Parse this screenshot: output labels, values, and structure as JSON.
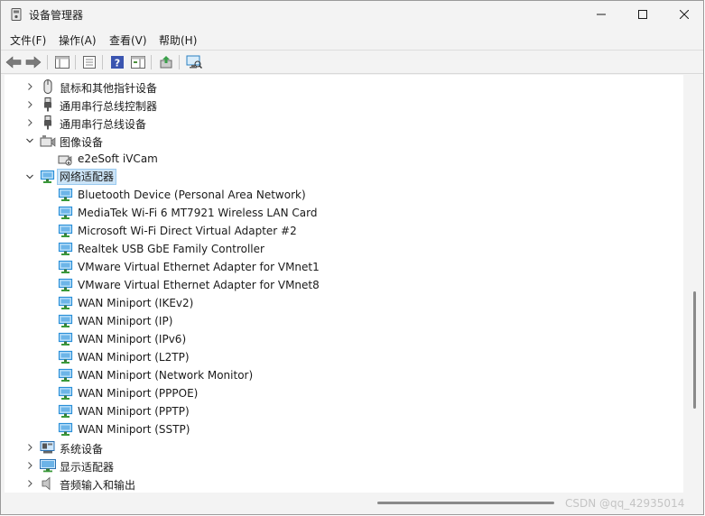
{
  "window": {
    "title": "设备管理器"
  },
  "menu": [
    {
      "label": "文件(F)"
    },
    {
      "label": "操作(A)"
    },
    {
      "label": "查看(V)"
    },
    {
      "label": "帮助(H)"
    }
  ],
  "tree": {
    "rows": [
      {
        "label": "鼠标和其他指针设备",
        "level": 0,
        "expanded": false,
        "icon": "mouse-icon"
      },
      {
        "label": "通用串行总线控制器",
        "level": 0,
        "expanded": false,
        "icon": "usb-icon"
      },
      {
        "label": "通用串行总线设备",
        "level": 0,
        "expanded": false,
        "icon": "usb-icon"
      },
      {
        "label": "图像设备",
        "level": 0,
        "expanded": true,
        "icon": "camera-icon"
      },
      {
        "label": "e2eSoft iVCam",
        "level": 1,
        "icon": "camera-device-icon"
      },
      {
        "label": "网络适配器",
        "level": 0,
        "expanded": true,
        "selected": true,
        "icon": "network-adapter-icon"
      },
      {
        "label": "Bluetooth Device (Personal Area Network)",
        "level": 1,
        "icon": "network-adapter-icon"
      },
      {
        "label": "MediaTek Wi-Fi 6 MT7921 Wireless LAN Card",
        "level": 1,
        "icon": "network-adapter-icon"
      },
      {
        "label": "Microsoft Wi-Fi Direct Virtual Adapter #2",
        "level": 1,
        "icon": "network-adapter-icon"
      },
      {
        "label": "Realtek USB GbE Family Controller",
        "level": 1,
        "icon": "network-adapter-icon"
      },
      {
        "label": "VMware Virtual Ethernet Adapter for VMnet1",
        "level": 1,
        "icon": "network-adapter-icon"
      },
      {
        "label": "VMware Virtual Ethernet Adapter for VMnet8",
        "level": 1,
        "icon": "network-adapter-icon"
      },
      {
        "label": "WAN Miniport (IKEv2)",
        "level": 1,
        "icon": "network-adapter-icon"
      },
      {
        "label": "WAN Miniport (IP)",
        "level": 1,
        "icon": "network-adapter-icon"
      },
      {
        "label": "WAN Miniport (IPv6)",
        "level": 1,
        "icon": "network-adapter-icon"
      },
      {
        "label": "WAN Miniport (L2TP)",
        "level": 1,
        "icon": "network-adapter-icon"
      },
      {
        "label": "WAN Miniport (Network Monitor)",
        "level": 1,
        "icon": "network-adapter-icon"
      },
      {
        "label": "WAN Miniport (PPPOE)",
        "level": 1,
        "icon": "network-adapter-icon"
      },
      {
        "label": "WAN Miniport (PPTP)",
        "level": 1,
        "icon": "network-adapter-icon"
      },
      {
        "label": "WAN Miniport (SSTP)",
        "level": 1,
        "icon": "network-adapter-icon"
      },
      {
        "label": "系统设备",
        "level": 0,
        "expanded": false,
        "icon": "system-device-icon"
      },
      {
        "label": "显示适配器",
        "level": 0,
        "expanded": false,
        "icon": "display-adapter-icon"
      },
      {
        "label": "音频输入和输出",
        "level": 0,
        "expanded": false,
        "icon": "speaker-icon"
      }
    ]
  },
  "scroll": {
    "vertical_position": 0.72,
    "vertical_visible_fraction": 0.28,
    "horizontal_position": 0.74,
    "horizontal_visible_fraction": 0.26
  },
  "watermark": "CSDN @qq_42935014",
  "colors": {
    "selection": "#cce4f7",
    "network_icon": "#2a8fd8"
  }
}
